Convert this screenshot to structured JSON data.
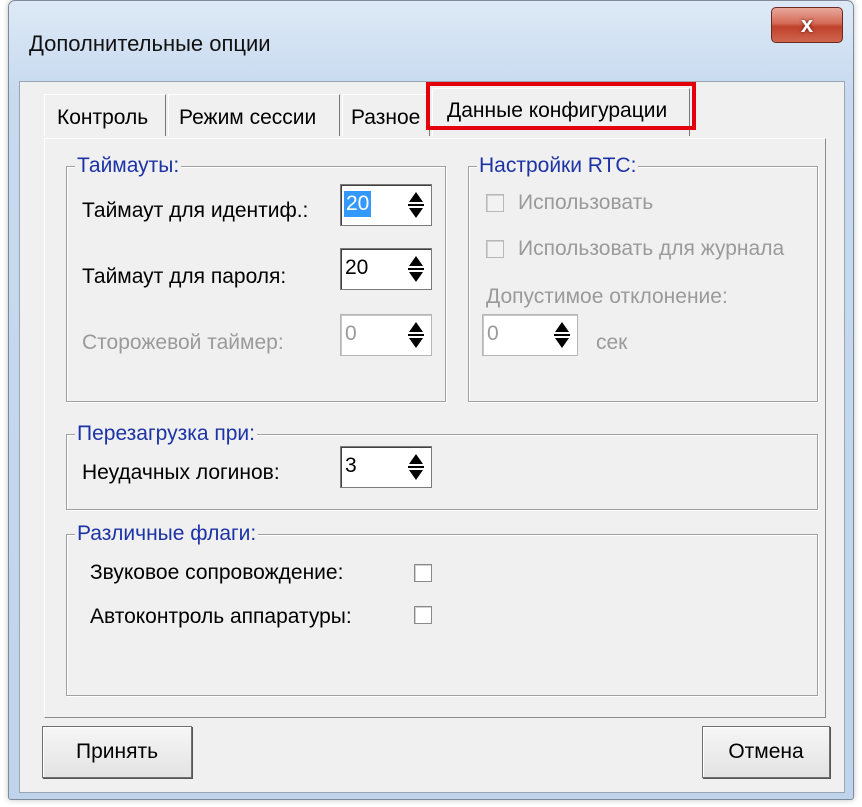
{
  "window": {
    "title": "Дополнительные опции",
    "close_glyph": "x"
  },
  "tabs": [
    {
      "label": "Контроль",
      "active": false
    },
    {
      "label": "Режим сессии",
      "active": false
    },
    {
      "label": "Разное",
      "active": false
    },
    {
      "label": "Данные конфигурации",
      "active": true
    }
  ],
  "timeouts": {
    "legend": "Таймауты:",
    "ident_label": "Таймаут для идентиф.:",
    "ident_value": "20",
    "password_label": "Таймаут для пароля:",
    "password_value": "20",
    "watchdog_label": "Сторожевой таймер:",
    "watchdog_value": "0"
  },
  "rtc": {
    "legend": "Настройки RTC:",
    "use_label": "Использовать",
    "use_journal_label": "Использовать для журнала",
    "deviation_label": "Допустимое отклонение:",
    "deviation_value": "0",
    "unit": "сек"
  },
  "reboot": {
    "legend": "Перезагрузка при:",
    "failed_logins_label": "Неудачных логинов:",
    "failed_logins_value": "3"
  },
  "flags": {
    "legend": "Различные флаги:",
    "sound_label": "Звуковое сопровождение:",
    "sound_checked": false,
    "selftest_label": "Автоконтроль аппаратуры:",
    "selftest_checked": false
  },
  "buttons": {
    "accept": "Принять",
    "cancel": "Отмена"
  },
  "colors": {
    "highlight": "#e3000b",
    "legend_text": "#1c33a6",
    "selection": "#3399ff"
  }
}
